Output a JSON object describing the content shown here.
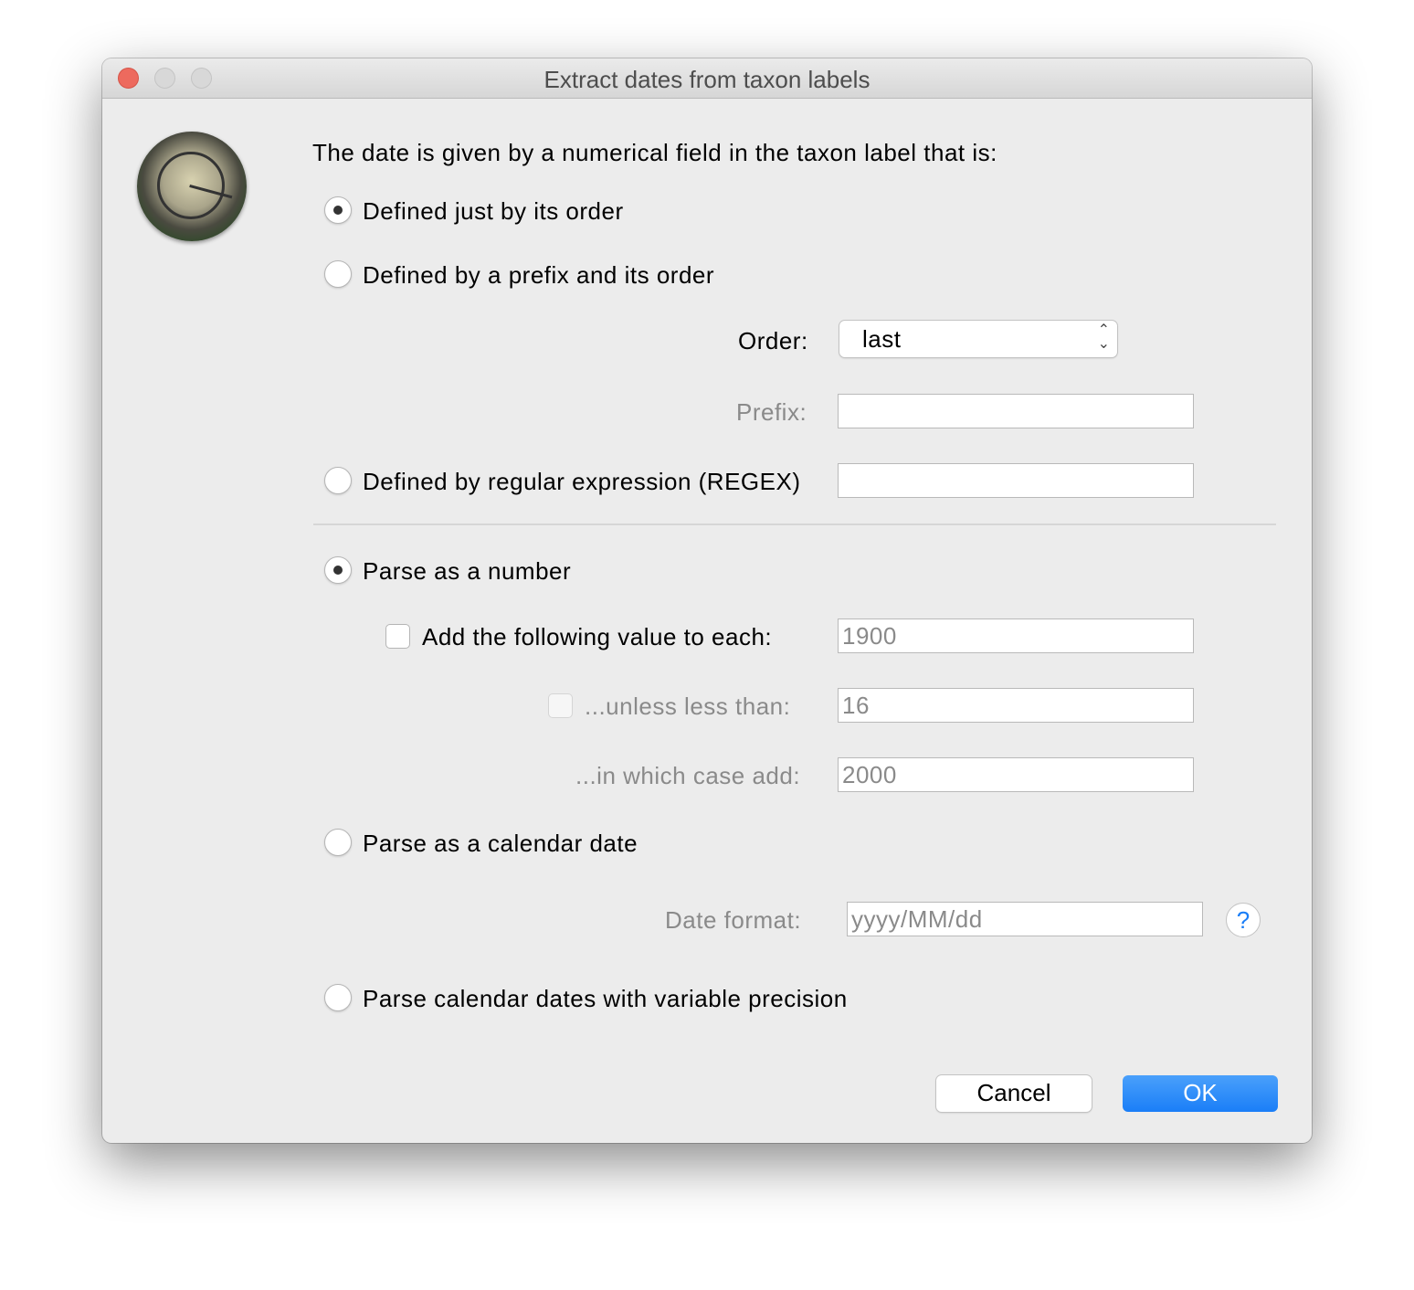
{
  "window": {
    "title": "Extract dates from taxon labels"
  },
  "icon": "clock-app-icon",
  "heading": "The date is given by a numerical field in the taxon label that is:",
  "field_options": [
    {
      "label": "Defined just by its order",
      "selected": true
    },
    {
      "label": "Defined by a prefix and its order",
      "selected": false
    },
    {
      "label": "Defined by regular expression (REGEX)",
      "selected": false
    }
  ],
  "order": {
    "label": "Order:",
    "value": "last"
  },
  "prefix": {
    "label": "Prefix:",
    "value": ""
  },
  "regex": {
    "value": ""
  },
  "parse_options": [
    {
      "label": "Parse as a number",
      "selected": true
    },
    {
      "label": "Parse as a calendar date",
      "selected": false
    },
    {
      "label": "Parse calendar dates with variable precision",
      "selected": false
    }
  ],
  "add_value": {
    "label": "Add the following value to each:",
    "checked": false,
    "value": "1900"
  },
  "unless": {
    "label": "...unless less than:",
    "checked": false,
    "value": "16"
  },
  "in_which_case": {
    "label": "...in which case add:",
    "value": "2000"
  },
  "date_format": {
    "label": "Date format:",
    "value": "yyyy/MM/dd",
    "help": "?"
  },
  "buttons": {
    "cancel": "Cancel",
    "ok": "OK"
  },
  "colors": {
    "accent": "#1a7ef7",
    "close": "#ed6a5e"
  }
}
